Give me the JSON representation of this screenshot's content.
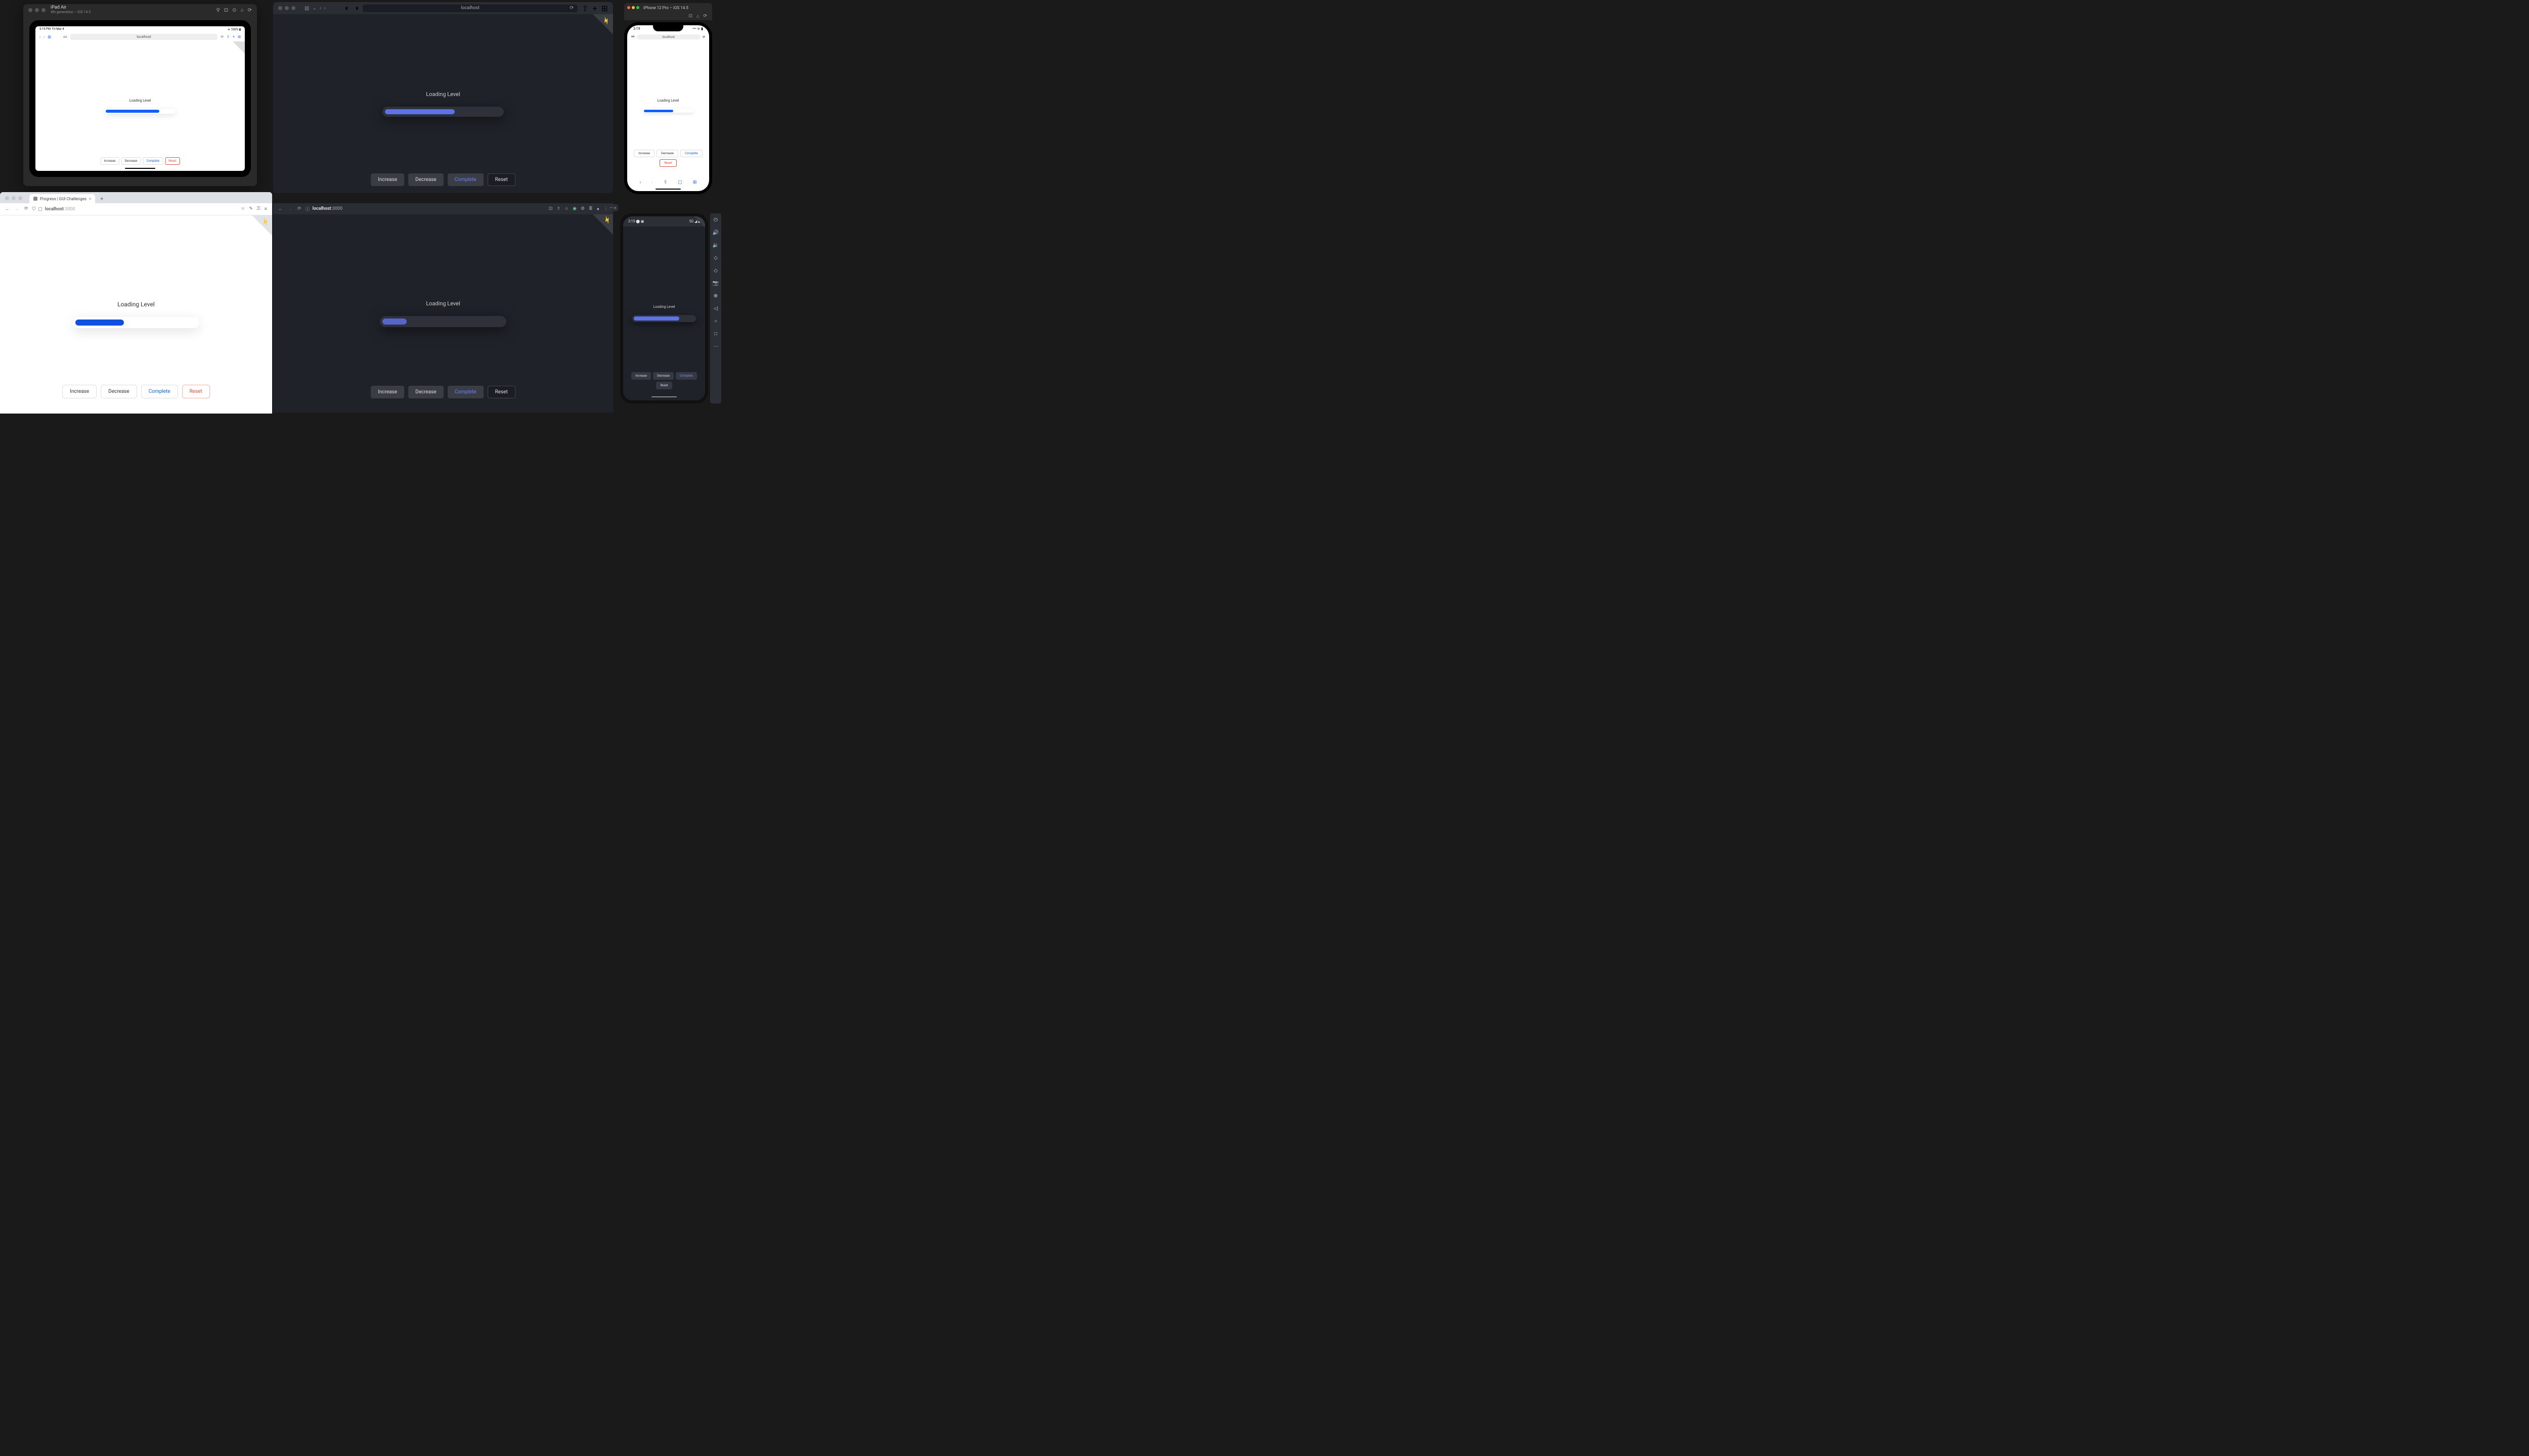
{
  "app": {
    "loading_label": "Loading Level",
    "buttons": {
      "increase": "Increase",
      "decrease": "Decrease",
      "complete": "Complete",
      "reset": "Reset"
    }
  },
  "ipad": {
    "window_title": "iPad Air",
    "window_subtitle": "4th generation – iOS 14.5",
    "status_time": "5:19 PM",
    "status_date": "Fri Mar 4",
    "status_right": "100%",
    "url": "localhost",
    "progress_pct": 78
  },
  "safari": {
    "url": "localhost",
    "progress_pct": 60
  },
  "iphone": {
    "window_title": "iPhone 12 Pro – iOS 14.5",
    "status_time": "3:19",
    "url": "localhost",
    "progress_pct": 60
  },
  "chrome_light": {
    "tab_title": "Progress | GUI Challenges",
    "url_host": "localhost",
    "url_port": ":3000",
    "progress_pct": 40
  },
  "chrome_dark": {
    "url_host": "localhost",
    "url_port": ":3000",
    "progress_pct": 20
  },
  "android": {
    "status_time": "3:19",
    "status_right": "5G",
    "progress_pct": 75
  },
  "colors": {
    "blue_light": "#1060ff",
    "blue_dark": "#5b72e8",
    "red": "#e74c3c",
    "bg_dark": "#1f2229"
  }
}
